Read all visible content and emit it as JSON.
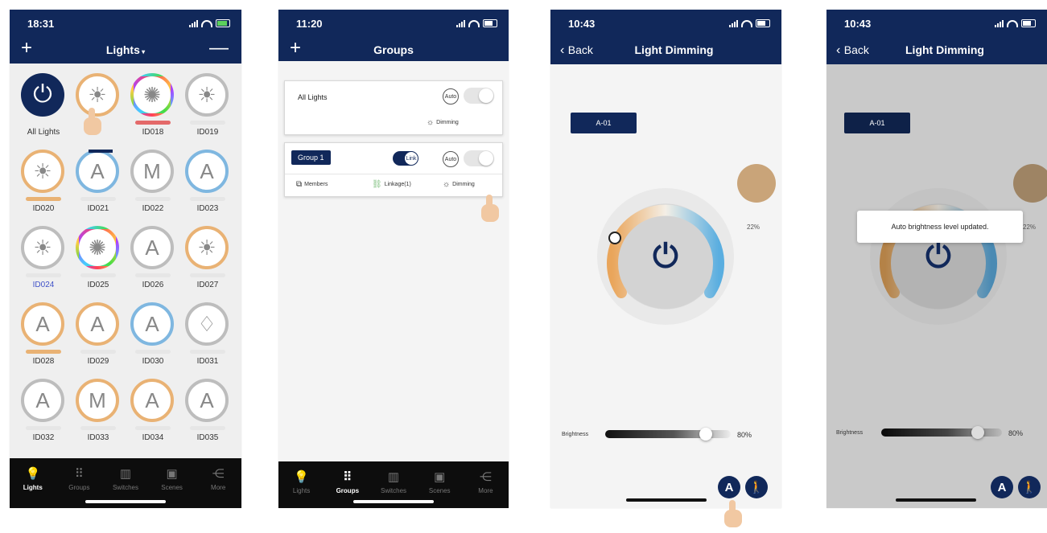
{
  "phone1": {
    "time": "18:31",
    "title": "Lights",
    "plus": "+",
    "minus": "—",
    "cells": [
      {
        "label": "All Lights",
        "icon": "power-icon"
      },
      {
        "label": "",
        "icon": "bulb-icon"
      },
      {
        "label": "ID018",
        "icon": "bulb-rgb-icon"
      },
      {
        "label": "ID019",
        "icon": "bulb-icon"
      },
      {
        "label": "ID020",
        "icon": "bulb-icon"
      },
      {
        "label": "ID021",
        "icon": "bulb-auto-icon"
      },
      {
        "label": "ID022",
        "icon": "bulb-manual-icon"
      },
      {
        "label": "ID023",
        "icon": "bulb-auto-icon"
      },
      {
        "label": "ID024",
        "icon": "bulb-icon"
      },
      {
        "label": "ID025",
        "icon": "bulb-rgb-icon"
      },
      {
        "label": "ID026",
        "icon": "bulb-auto-icon"
      },
      {
        "label": "ID027",
        "icon": "bulb-icon"
      },
      {
        "label": "ID028",
        "icon": "bulb-auto-icon"
      },
      {
        "label": "ID029",
        "icon": "bulb-auto-icon"
      },
      {
        "label": "ID030",
        "icon": "bulb-auto-icon"
      },
      {
        "label": "ID031",
        "icon": "bulb-icon"
      },
      {
        "label": "ID032",
        "icon": "bulb-auto-icon"
      },
      {
        "label": "ID033",
        "icon": "bulb-manual-icon"
      },
      {
        "label": "ID034",
        "icon": "bulb-auto-icon"
      },
      {
        "label": "ID035",
        "icon": "bulb-auto-icon"
      }
    ],
    "cell_glyphs": [
      "⏻",
      "☀",
      "✺",
      "☀",
      "☀",
      "A",
      "M",
      "A",
      "☀",
      "✺",
      "A",
      "☀",
      "A",
      "A",
      "A",
      "♢",
      "A",
      "M",
      "A",
      "A"
    ]
  },
  "tabs": [
    {
      "label": "Lights",
      "icon": "bulb-icon",
      "glyph": "💡"
    },
    {
      "label": "Groups",
      "icon": "groups-icon",
      "glyph": "⠿"
    },
    {
      "label": "Switches",
      "icon": "switches-icon",
      "glyph": "▥"
    },
    {
      "label": "Scenes",
      "icon": "scenes-icon",
      "glyph": "▣"
    },
    {
      "label": "More",
      "icon": "share-icon",
      "glyph": "⋲"
    }
  ],
  "phone2": {
    "time": "11:20",
    "title": "Groups",
    "plus": "+",
    "all_lights": {
      "title": "All Lights",
      "auto": "Auto",
      "dimming": "Dimming"
    },
    "group1": {
      "name": "Group 1",
      "link": "Link",
      "auto": "Auto",
      "members": "Members",
      "linkage": "Linkage(1)",
      "dimming": "Dimming"
    }
  },
  "phone3": {
    "time": "10:43",
    "back": "Back",
    "title": "Light Dimming",
    "chip": "A-01",
    "percent": "22%",
    "brightness_label": "Brightness",
    "brightness_value": "80%",
    "brightness_level": 0.8,
    "auto_glyph": "A",
    "motion_glyph": "🚶"
  },
  "phone4": {
    "time": "10:43",
    "back": "Back",
    "title": "Light Dimming",
    "chip": "A-01",
    "percent": "22%",
    "brightness_label": "Brightness",
    "brightness_value": "80%",
    "toast": "Auto brightness level updated.",
    "auto_glyph": "A",
    "motion_glyph": "🚶"
  },
  "colors": {
    "navy": "#11285a",
    "warm": "#e9b274",
    "cool": "#7fb7e0",
    "swatch": "#c9a479"
  }
}
